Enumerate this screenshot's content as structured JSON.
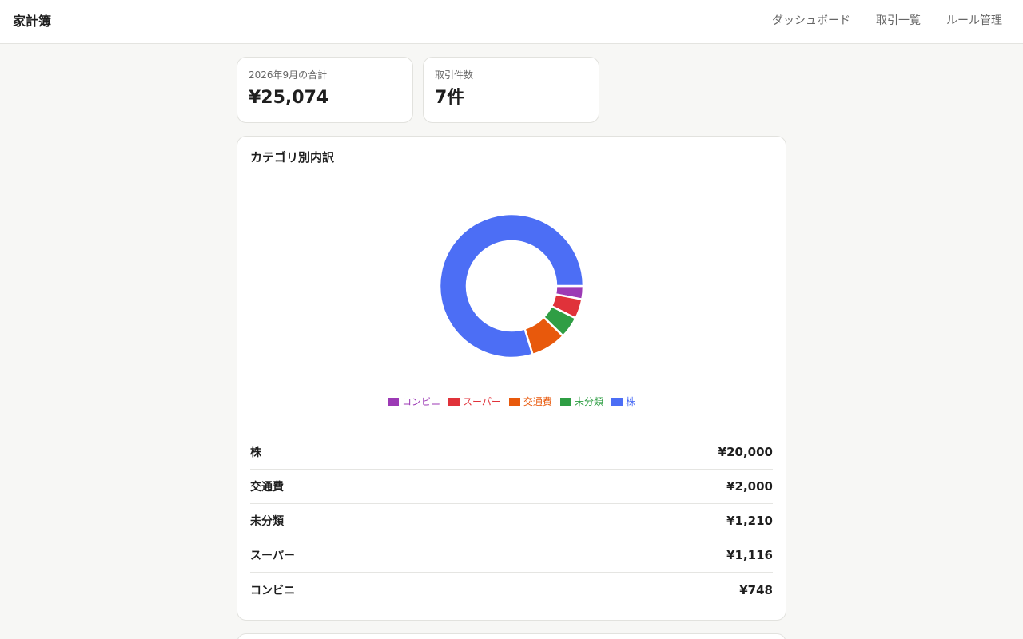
{
  "app": {
    "title": "家計簿"
  },
  "nav": [
    {
      "label": "ダッシュボード"
    },
    {
      "label": "取引一覧"
    },
    {
      "label": "ルール管理"
    }
  ],
  "summary": {
    "total_label": "2026年9月の合計",
    "total_value": "¥25,074",
    "count_label": "取引件数",
    "count_value": "7件"
  },
  "breakdown": {
    "title": "カテゴリ別内訳",
    "rows": [
      {
        "name": "株",
        "amount": "¥20,000"
      },
      {
        "name": "交通費",
        "amount": "¥2,000"
      },
      {
        "name": "未分類",
        "amount": "¥1,210"
      },
      {
        "name": "スーパー",
        "amount": "¥1,116"
      },
      {
        "name": "コンビニ",
        "amount": "¥748"
      }
    ]
  },
  "chart_data": {
    "type": "pie",
    "categories": [
      "コンビニ",
      "スーパー",
      "交通費",
      "未分類",
      "株"
    ],
    "values": [
      748,
      1116,
      2000,
      1210,
      20000
    ],
    "slice_order": [
      "コンビニ",
      "スーパー",
      "未分類",
      "交通費",
      "株"
    ],
    "colors": {
      "コンビニ": "#9c3ab5",
      "スーパー": "#e0323a",
      "交通費": "#e8590c",
      "未分類": "#2f9e44",
      "株": "#4c6ef5"
    },
    "legend_placement": "bottom",
    "legend": [
      "コンビニ",
      "スーパー",
      "交通費",
      "未分類",
      "株"
    ]
  }
}
